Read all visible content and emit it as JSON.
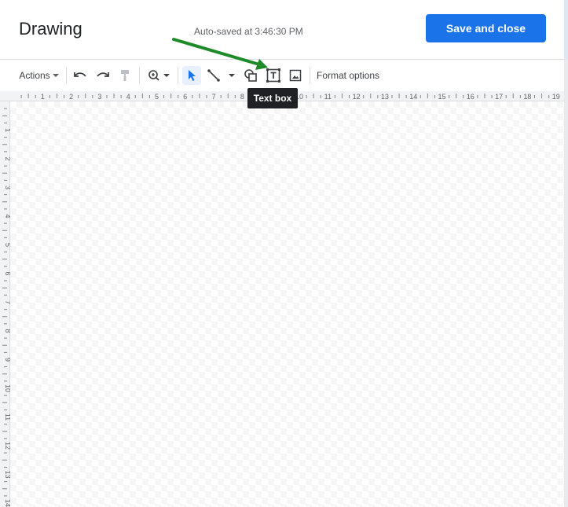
{
  "header": {
    "title": "Drawing",
    "autosave_text": "Auto-saved at 3:46:30 PM",
    "save_label": "Save and close"
  },
  "toolbar": {
    "actions_label": "Actions",
    "format_options_label": "Format options",
    "tooltip_text": "Text box",
    "items": [
      "actions-menu",
      "undo-icon",
      "redo-icon",
      "paint-format-icon",
      "zoom-icon",
      "select-icon",
      "line-icon",
      "shape-icon",
      "text-box-icon",
      "image-icon"
    ]
  },
  "ruler": {
    "horizontal_labels": [
      "1",
      "2",
      "3",
      "4",
      "5",
      "6",
      "7",
      "8",
      "9",
      "10",
      "11",
      "12",
      "13",
      "14",
      "15",
      "16",
      "17",
      "18",
      "19"
    ],
    "vertical_labels": [
      "1",
      "2",
      "3",
      "4",
      "5",
      "6",
      "7",
      "8",
      "9",
      "10",
      "11",
      "12",
      "13",
      "14"
    ]
  },
  "colors": {
    "accent": "#1a73e8",
    "annotation_arrow": "#1e8a2a",
    "tooltip_bg": "#202124"
  }
}
